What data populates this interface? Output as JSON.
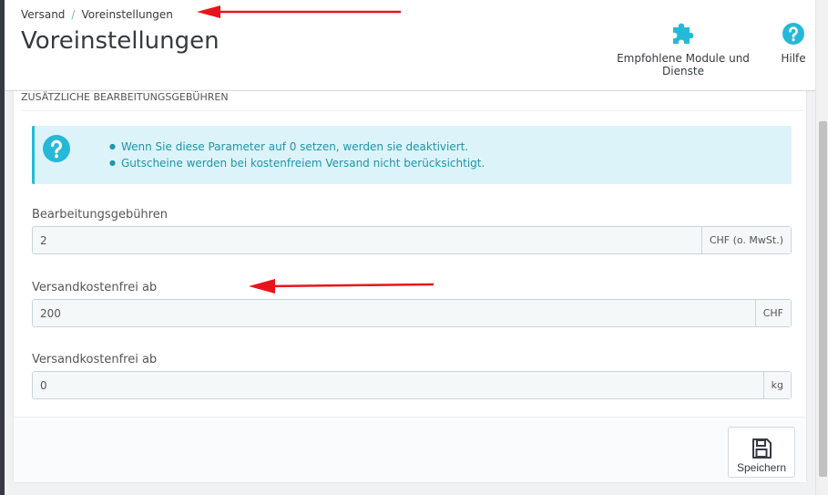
{
  "breadcrumb": {
    "parent": "Versand",
    "separator": "/",
    "current": "Voreinstellungen"
  },
  "page_title": "Voreinstellungen",
  "toolbar": {
    "modules_label": "Empfohlene Module und Dienste",
    "modules_icon": "puzzle-icon",
    "help_label": "Hilfe",
    "help_icon": "question-circle-icon"
  },
  "panel": {
    "heading": "Zusätzliche Bearbeitungsgebühren",
    "info": {
      "icon": "question-circle-icon",
      "lines": [
        "Wenn Sie diese Parameter auf 0 setzen, werden sie deaktiviert.",
        "Gutscheine werden bei kostenfreiem Versand nicht berücksichtigt."
      ]
    },
    "fields": [
      {
        "label": "Bearbeitungsgebühren",
        "value": "2",
        "addon": "CHF (o. MwSt.)"
      },
      {
        "label": "Versandkostenfrei ab",
        "value": "200",
        "addon": "CHF"
      },
      {
        "label": "Versandkostenfrei ab",
        "value": "0",
        "addon": "kg"
      }
    ],
    "save_label": "Speichern",
    "save_icon": "floppy-disk-icon"
  },
  "colors": {
    "accent": "#25b9d7",
    "info_background": "#dcf4f9",
    "annotation_arrow": "#e8141b",
    "breadcrumb_separator": "#72c279"
  }
}
